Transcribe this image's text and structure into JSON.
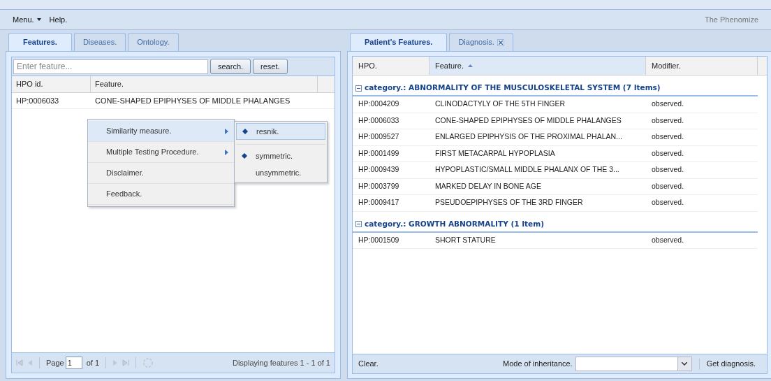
{
  "menubar": {
    "items": [
      {
        "label": "Menu.",
        "dropdown": true
      },
      {
        "label": "Help.",
        "dropdown": false
      }
    ],
    "title": "The Phenomize"
  },
  "left": {
    "tabs": [
      {
        "label": "Features.",
        "selected": true
      },
      {
        "label": "Diseases.",
        "selected": false
      },
      {
        "label": "Ontology.",
        "selected": false
      }
    ],
    "search": {
      "placeholder": "Enter feature..."
    },
    "buttons": [
      "search.",
      "reset."
    ],
    "table": {
      "columns": [
        "HPO id.",
        "Feature."
      ],
      "rows": [
        [
          "HP:0006033",
          "CONE-SHAPED EPIPHYSES OF MIDDLE PHALANGES"
        ]
      ]
    },
    "context_menu": {
      "items": [
        {
          "label": "Similarity measure.",
          "submenu": true,
          "highlighted": true
        },
        {
          "label": "Multiple Testing Procedure.",
          "submenu": true,
          "highlighted": false
        },
        {
          "label": "Disclaimer.",
          "submenu": false,
          "highlighted": false
        },
        {
          "label": "Feedback.",
          "submenu": false,
          "highlighted": false
        }
      ],
      "submenu": {
        "groups": [
          [
            {
              "label": "resnik.",
              "selected": true,
              "highlighted": true
            }
          ],
          [
            {
              "label": "symmetric.",
              "selected": true,
              "highlighted": false
            },
            {
              "label": "unsymmetric.",
              "selected": false,
              "highlighted": false
            }
          ]
        ]
      }
    },
    "pager": {
      "page_label": "Page",
      "page": "1",
      "of": "of 1",
      "status": "Displaying features 1 - 1 of 1"
    }
  },
  "right": {
    "tabs": [
      {
        "label": "Patient's Features.",
        "selected": true,
        "closable": false
      },
      {
        "label": "Diagnosis.",
        "selected": false,
        "closable": true
      }
    ],
    "table": {
      "columns": [
        {
          "label": "HPO.",
          "sorted": false
        },
        {
          "label": "Feature.",
          "sorted": true
        },
        {
          "label": "Modifier.",
          "sorted": false
        }
      ],
      "groups": [
        {
          "title": "category.: ABNORMALITY OF THE MUSCULOSKELETAL SYSTEM (7 Items)",
          "expanded": true,
          "rows": [
            [
              "HP:0004209",
              "CLINODACTYLY OF THE 5TH FINGER",
              "observed."
            ],
            [
              "HP:0006033",
              "CONE-SHAPED EPIPHYSES OF MIDDLE PHALANGES",
              "observed."
            ],
            [
              "HP:0009527",
              "ENLARGED EPIPHYSIS OF THE PROXIMAL PHALAN...",
              "observed."
            ],
            [
              "HP:0001499",
              "FIRST METACARPAL HYPOPLASIA",
              "observed."
            ],
            [
              "HP:0009439",
              "HYPOPLASTIC/SMALL MIDDLE PHALANX OF THE 3...",
              "observed."
            ],
            [
              "HP:0003799",
              "MARKED DELAY IN BONE AGE",
              "observed."
            ],
            [
              "HP:0009417",
              "PSEUDOEPIPHYSES OF THE 3RD FINGER",
              "observed."
            ]
          ]
        },
        {
          "title": "category.: GROWTH ABNORMALITY (1 Item)",
          "expanded": true,
          "rows": [
            [
              "HP:0001509",
              "SHORT STATURE",
              "observed."
            ]
          ]
        }
      ]
    },
    "toolbar": {
      "clear": "Clear.",
      "mode_label": "Mode of inheritance.",
      "get": "Get diagnosis."
    }
  }
}
